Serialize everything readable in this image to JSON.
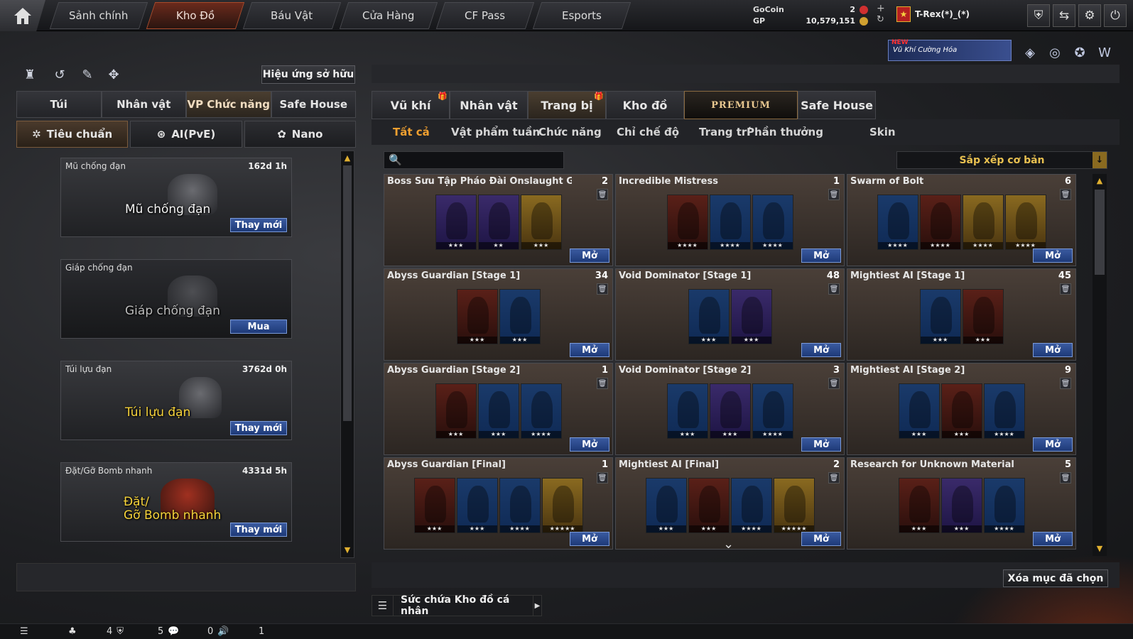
{
  "topbar": {
    "home_icon": "home-icon",
    "nav": [
      "Sảnh chính",
      "Kho Đồ",
      "Báu Vật",
      "Cửa Hàng",
      "CF Pass",
      "Esports"
    ],
    "active_nav": "Kho Đồ",
    "currency": {
      "gocoin_label": "GoCoin",
      "gocoin_value": "2",
      "gp_label": "GP",
      "gp_value": "10,579,151"
    },
    "user": {
      "name": "T-Rex(*)_(*)"
    },
    "icons": [
      "shield-icon",
      "exchange-icon",
      "gear-icon",
      "power-icon"
    ]
  },
  "promo": {
    "new": "NEW",
    "text": "Vũ Khí Cường Hóa"
  },
  "left": {
    "owned_effects_btn": "Hiệu ứng sở hữu",
    "tabs": [
      "Túi",
      "Nhân vật",
      "VP Chức năng",
      "Safe House"
    ],
    "active_tab": "VP Chức năng",
    "subtabs": [
      "Tiêu chuẩn",
      "AI(PvE)",
      "Nano"
    ],
    "items": [
      {
        "name": "Mũ chống đạn",
        "time": "162d 1h",
        "big": "Mũ chống đạn",
        "action": "Thay mới"
      },
      {
        "name": "Giáp chống đạn",
        "time": "",
        "big": "Giáp chống đạn",
        "action": "Mua"
      },
      {
        "name": "Túi lựu đạn",
        "time": "3762d 0h",
        "big": "Túi lựu đạn",
        "action": "Thay mới"
      },
      {
        "name": "Đặt/Gỡ Bomb nhanh",
        "time": "4331d 5h",
        "big": "Đặt/\nGỡ Bomb nhanh",
        "action": "Thay mới"
      }
    ]
  },
  "right": {
    "tabs": [
      "Vũ khí",
      "Nhân vật",
      "Trang bị",
      "Kho đồ",
      "PREMIUM",
      "Safe House"
    ],
    "active_tab": "Trang bị",
    "subtabs": [
      "Tất cả",
      "Vật phẩm tuần",
      "Chức năng",
      "Chỉ chế độ",
      "Trang trí",
      "Phần thưởng",
      "Skin"
    ],
    "active_subtab": "Tất cả",
    "search_placeholder": "",
    "sort_label": "Sắp xếp cơ bản",
    "open_label": "Mở",
    "cards": [
      {
        "title": "Boss Sưu Tập Pháo Đài Onslaught G",
        "count": "2",
        "chars": [
          [
            "purp",
            "★★★"
          ],
          [
            "purp",
            "★★"
          ],
          [
            "gold",
            "★★★"
          ]
        ]
      },
      {
        "title": "Incredible Mistress",
        "count": "1",
        "chars": [
          [
            "red",
            "★★★★"
          ],
          [
            "blue",
            "★★★★"
          ],
          [
            "blue",
            "★★★★"
          ]
        ]
      },
      {
        "title": "Swarm of Bolt",
        "count": "6",
        "chars": [
          [
            "blue",
            "★★★★"
          ],
          [
            "red",
            "★★★★"
          ],
          [
            "gold",
            "★★★★"
          ],
          [
            "gold",
            "★★★★"
          ]
        ]
      },
      {
        "title": "Abyss Guardian [Stage 1]",
        "count": "34",
        "chars": [
          [
            "red",
            "★★★"
          ],
          [
            "blue",
            "★★★"
          ]
        ]
      },
      {
        "title": "Void Dominator [Stage 1]",
        "count": "48",
        "chars": [
          [
            "blue",
            "★★★"
          ],
          [
            "purp",
            "★★★"
          ]
        ]
      },
      {
        "title": "Mightiest AI [Stage 1]",
        "count": "45",
        "chars": [
          [
            "blue",
            "★★★"
          ],
          [
            "red",
            "★★★"
          ]
        ]
      },
      {
        "title": "Abyss Guardian [Stage 2]",
        "count": "1",
        "chars": [
          [
            "red",
            "★★★"
          ],
          [
            "blue",
            "★★★"
          ],
          [
            "blue",
            "★★★★"
          ]
        ]
      },
      {
        "title": "Void Dominator [Stage 2]",
        "count": "3",
        "chars": [
          [
            "blue",
            "★★★"
          ],
          [
            "purp",
            "★★★"
          ],
          [
            "blue",
            "★★★★"
          ]
        ]
      },
      {
        "title": "Mightiest AI [Stage 2]",
        "count": "9",
        "chars": [
          [
            "blue",
            "★★★"
          ],
          [
            "red",
            "★★★"
          ],
          [
            "blue",
            "★★★★"
          ]
        ]
      },
      {
        "title": "Abyss Guardian [Final]",
        "count": "1",
        "chars": [
          [
            "red",
            "★★★"
          ],
          [
            "blue",
            "★★★"
          ],
          [
            "blue",
            "★★★★"
          ],
          [
            "gold",
            "★★★★★"
          ]
        ]
      },
      {
        "title": "Mightiest AI [Final]",
        "count": "2",
        "chars": [
          [
            "blue",
            "★★★"
          ],
          [
            "red",
            "★★★"
          ],
          [
            "blue",
            "★★★★"
          ],
          [
            "gold",
            "★★★★★"
          ]
        ]
      },
      {
        "title": "Research for Unknown Material",
        "count": "5",
        "chars": [
          [
            "red",
            "★★★"
          ],
          [
            "purp",
            "★★★"
          ],
          [
            "blue",
            "★★★★"
          ]
        ]
      }
    ],
    "clear_btn": "Xóa mục đã chọn",
    "capacity_label": "Sức chứa Kho đồ cá nhân"
  },
  "status": {
    "v1": "4",
    "v2": "5",
    "v3": "0",
    "v4": "1"
  }
}
